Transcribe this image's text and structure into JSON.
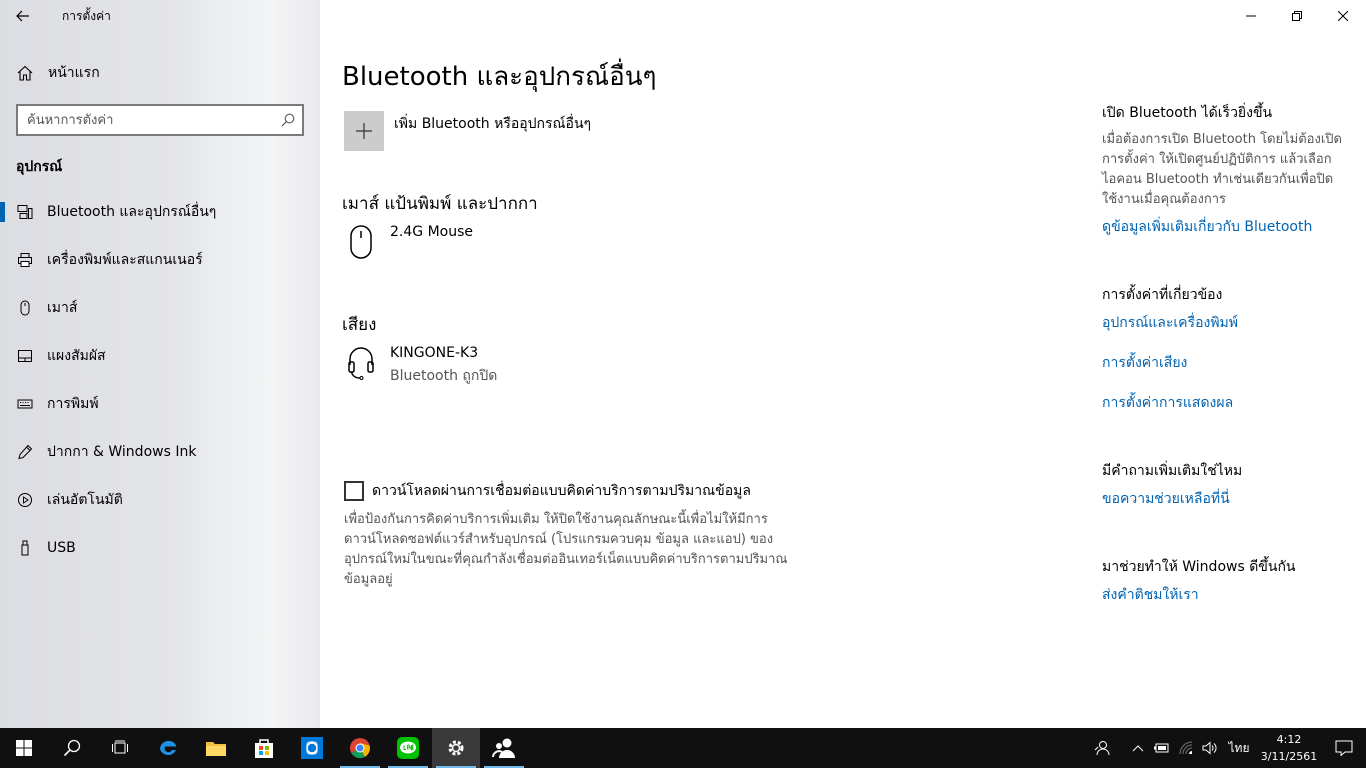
{
  "app": {
    "title": "การตั้งค่า"
  },
  "sidebar": {
    "home_label": "หน้าแรก",
    "search_placeholder": "ค้นหาการตั้งค่า",
    "section_title": "อุปกรณ์",
    "items": [
      {
        "label": "Bluetooth และอุปกรณ์อื่นๆ",
        "icon": "bluetooth-devices-icon",
        "active": true
      },
      {
        "label": "เครื่องพิมพ์และสแกนเนอร์",
        "icon": "printer-icon"
      },
      {
        "label": "เมาส์",
        "icon": "mouse-icon"
      },
      {
        "label": "แผงสัมผัส",
        "icon": "touchpad-icon"
      },
      {
        "label": "การพิมพ์",
        "icon": "keyboard-icon"
      },
      {
        "label": "ปากกา & Windows Ink",
        "icon": "pen-icon"
      },
      {
        "label": "เล่นอัตโนมัติ",
        "icon": "autoplay-icon"
      },
      {
        "label": "USB",
        "icon": "usb-icon"
      }
    ]
  },
  "main": {
    "title": "Bluetooth และอุปกรณ์อื่นๆ",
    "add_label": "เพิ่ม Bluetooth หรืออุปกรณ์อื่นๆ",
    "sections": [
      {
        "heading": "เมาส์ แป้นพิมพ์ และปากกา",
        "devices": [
          {
            "name": "2.4G Mouse",
            "status": "",
            "icon": "mouse-icon"
          }
        ]
      },
      {
        "heading": "เสียง",
        "devices": [
          {
            "name": "KINGONE-K3",
            "status": "Bluetooth ถูกปิด",
            "icon": "headset-icon"
          }
        ]
      }
    ],
    "metered": {
      "label": "ดาวน์โหลดผ่านการเชื่อมต่อแบบคิดค่าบริการตามปริมาณข้อมูล",
      "checked": false,
      "description": "เพื่อป้องกันการคิดค่าบริการเพิ่มเติม ให้ปิดใช้งานคุณลักษณะนี้เพื่อไม่ให้มีการดาวน์โหลดซอฟต์แวร์สำหรับอุปกรณ์ (โปรแกรมควบคุม ข้อมูล และแอป) ของอุปกรณ์ใหม่ในขณะที่คุณกำลังเชื่อมต่ออินเทอร์เน็ตแบบคิดค่าบริการตามปริมาณข้อมูลอยู่"
    }
  },
  "right": {
    "quick": {
      "heading": "เปิด Bluetooth ได้เร็วยิ่งขึ้น",
      "text": "เมื่อต้องการเปิด Bluetooth โดยไม่ต้องเปิดการตั้งค่า ให้เปิดศูนย์ปฏิบัติการ แล้วเลือกไอคอน Bluetooth ทำเช่นเดียวกันเพื่อปิดใช้งานเมื่อคุณต้องการ",
      "link": "ดูข้อมูลเพิ่มเติมเกี่ยวกับ Bluetooth"
    },
    "related": {
      "heading": "การตั้งค่าที่เกี่ยวข้อง",
      "links": [
        "อุปกรณ์และเครื่องพิมพ์",
        "การตั้งค่าเสียง",
        "การตั้งค่าการแสดงผล"
      ]
    },
    "question": {
      "heading": "มีคำถามเพิ่มเติมใช่ไหม",
      "link": "ขอความช่วยเหลือที่นี่"
    },
    "feedback": {
      "heading": "มาช่วยทำให้ Windows ดีขึ้นกัน",
      "link": "ส่งคำติชมให้เรา"
    }
  },
  "taskbar": {
    "language": "ไทย",
    "time": "4:12",
    "date": "3/11/2561"
  },
  "colors": {
    "accent": "#0063b1",
    "taskbar": "#101010"
  }
}
